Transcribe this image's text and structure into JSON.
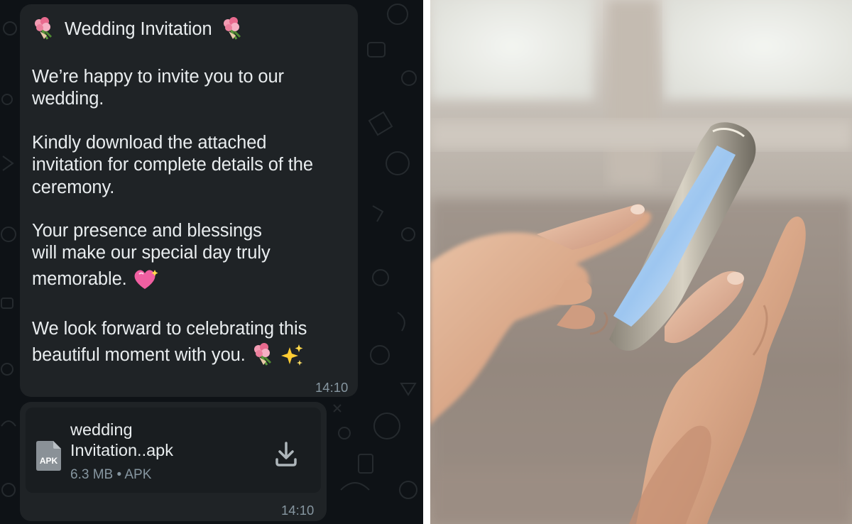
{
  "chat": {
    "message": {
      "title": "Wedding Invitation",
      "title_emoji_left": "bouquet-emoji",
      "title_emoji_right": "bouquet-emoji",
      "paragraphs": [
        [
          "We’re happy to invite you to our",
          "wedding."
        ],
        [
          "Kindly download the attached",
          "invitation for complete details of the",
          "ceremony."
        ],
        [
          "Your presence and blessings",
          "will make our special day truly",
          "memorable."
        ],
        [
          "We look forward to celebrating this",
          "beautiful moment with you."
        ]
      ],
      "heart_emoji": "sparkling-heart-emoji",
      "end_emojis": [
        "bouquet-emoji",
        "sparkles-emoji"
      ],
      "time": "14:10"
    },
    "attachment": {
      "file_icon_label": "APK",
      "file_name_line1": "wedding",
      "file_name_line2": "Invitation..apk",
      "meta": "6.3 MB • APK",
      "time": "14:10",
      "action_icon": "download-icon"
    }
  },
  "colors": {
    "chat_background": "#0e1216",
    "bubble": "#1f2326",
    "file_card": "#191d20",
    "text": "#e9edef",
    "secondary_text": "#8696a0"
  },
  "photo": {
    "subject": "hands-holding-smartphone-photo"
  }
}
